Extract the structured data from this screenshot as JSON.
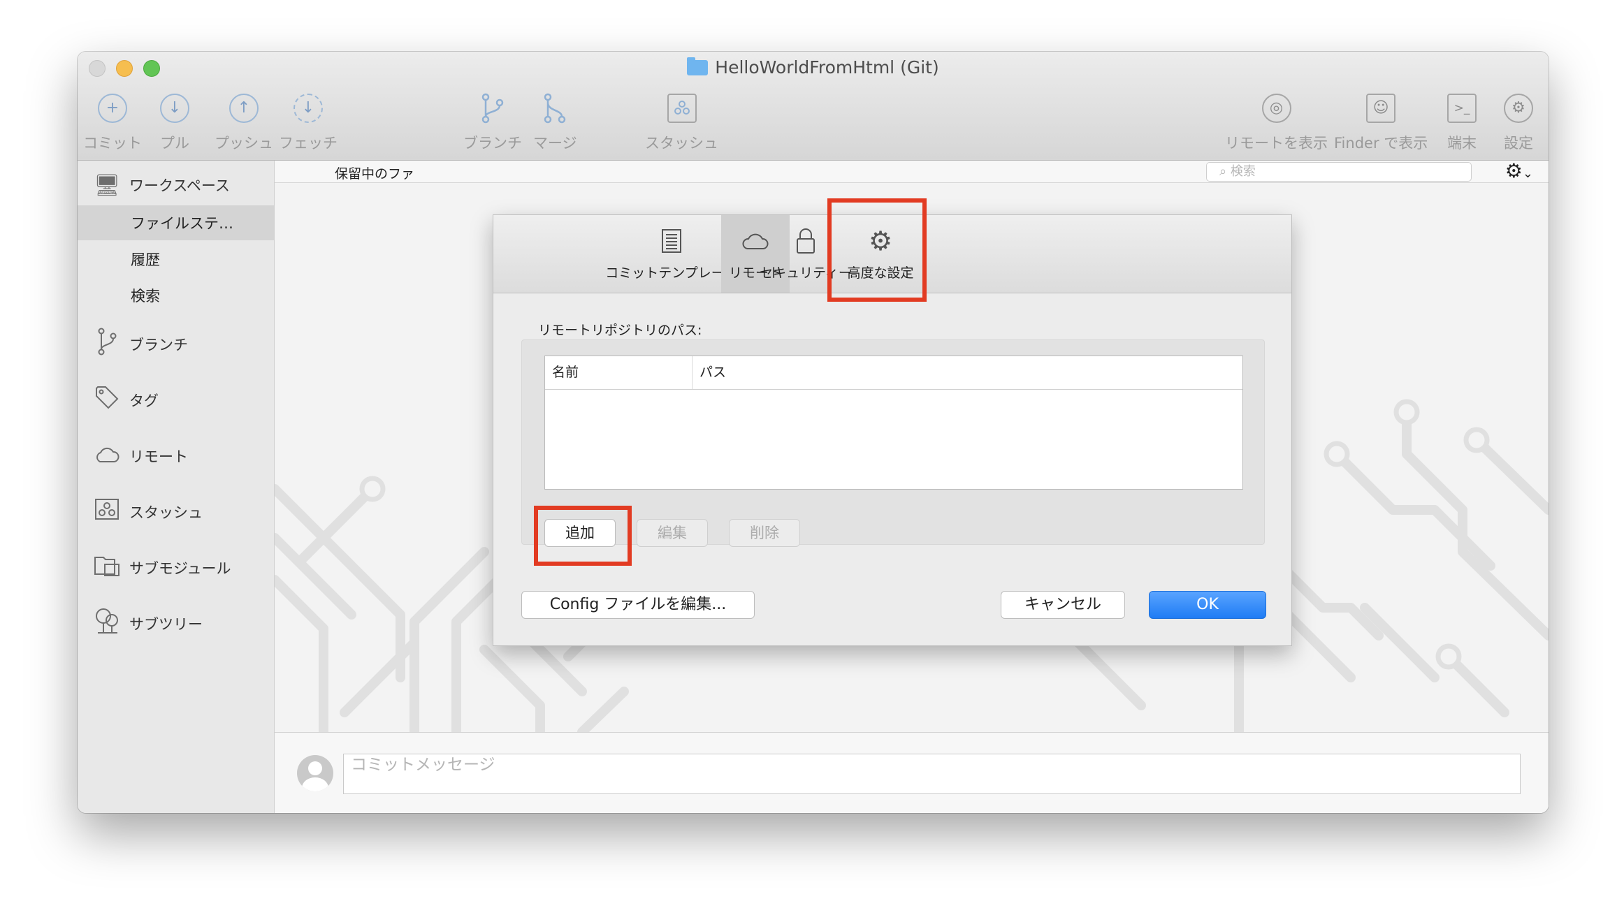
{
  "window": {
    "title": "HelloWorldFromHtml (Git)"
  },
  "toolbar": {
    "commit": "コミット",
    "pull": "プル",
    "push": "プッシュ",
    "fetch": "フェッチ",
    "branch": "ブランチ",
    "merge": "マージ",
    "stash": "スタッシュ",
    "show_remote": "リモートを表示",
    "show_in_finder": "Finder で表示",
    "terminal": "端末",
    "settings": "設定"
  },
  "sidebar": {
    "workspace": "ワークスペース",
    "file_status": "ファイルステ…",
    "history": "履歴",
    "search": "検索",
    "branches": "ブランチ",
    "tags": "タグ",
    "remotes": "リモート",
    "stashes": "スタッシュ",
    "submodules": "サブモジュール",
    "subtrees": "サブツリー"
  },
  "content": {
    "pending_label": "保留中のファ",
    "search_placeholder": "検索",
    "commit_placeholder": "コミットメッセージ"
  },
  "dialog": {
    "tabs": {
      "commit_template": "コミットテンプレート",
      "remote": "リモート",
      "security": "セキュリティー",
      "advanced": "高度な設定"
    },
    "active_tab": "remote",
    "remote_path_label": "リモートリポジトリのパス:",
    "columns": {
      "name": "名前",
      "path": "パス"
    },
    "remotes": [],
    "add_button": "追加",
    "edit_button": "編集",
    "delete_button": "削除",
    "edit_config_button": "Config ファイルを編集...",
    "cancel_button": "キャンセル",
    "ok_button": "OK"
  },
  "colors": {
    "highlight": "#e23b22",
    "primary_button": "#1f7cf4",
    "traffic_min": "#f6be4f",
    "traffic_max": "#62c555"
  }
}
